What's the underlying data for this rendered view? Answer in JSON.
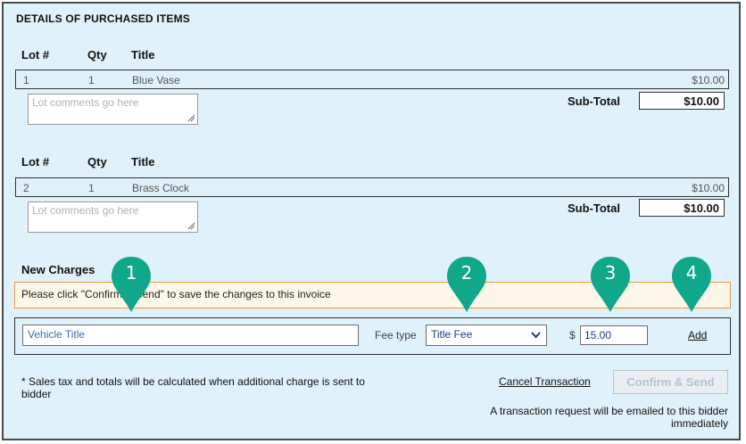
{
  "section_title": "DETAILS OF PURCHASED ITEMS",
  "columns": {
    "lot": "Lot #",
    "qty": "Qty",
    "title": "Title"
  },
  "items": [
    {
      "lot": "1",
      "qty": "1",
      "title": "Blue Vase",
      "price": "$10.00",
      "comment_placeholder": "Lot comments go here",
      "subtotal_label": "Sub-Total",
      "subtotal": "$10.00"
    },
    {
      "lot": "2",
      "qty": "1",
      "title": "Brass Clock",
      "price": "$10.00",
      "comment_placeholder": "Lot comments go here",
      "subtotal_label": "Sub-Total",
      "subtotal": "$10.00"
    }
  ],
  "new_charges": {
    "heading": "New Charges",
    "notice": "Please click \"Confirm & Send\" to save the changes to this invoice",
    "description_value": "Vehicle Title",
    "fee_type_label": "Fee type",
    "fee_type_selected": "Title Fee",
    "currency": "$",
    "amount_value": "15.00",
    "add_label": "Add"
  },
  "footer": {
    "tax_note": "* Sales tax and totals will be calculated when additional charge is sent to bidder",
    "cancel_label": "Cancel Transaction",
    "confirm_label": "Confirm & Send",
    "email_note": "A transaction request will be emailed to this bidder immediately"
  },
  "markers": [
    "1",
    "2",
    "3",
    "4"
  ],
  "colors": {
    "background": "#dff1fb",
    "marker": "#0fa88a",
    "notice_border": "#e99b3d"
  }
}
